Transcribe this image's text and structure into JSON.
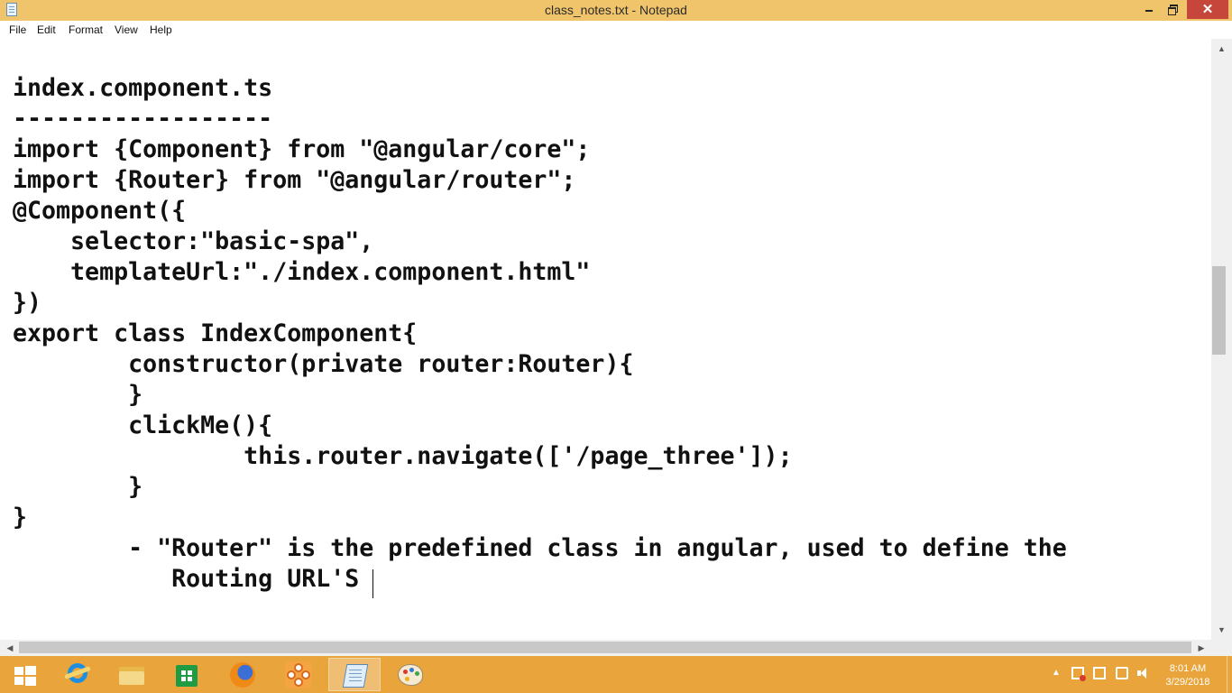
{
  "window": {
    "title": "class_notes.txt - Notepad",
    "controls": {
      "minimize": "",
      "maximize": "",
      "close": "✕"
    }
  },
  "menu": [
    "File",
    "Edit",
    "Format",
    "View",
    "Help"
  ],
  "editor": {
    "text": "index.component.ts\n------------------\nimport {Component} from \"@angular/core\";\nimport {Router} from \"@angular/router\";\n@Component({\n    selector:\"basic-spa\",\n    templateUrl:\"./index.component.html\"\n})\nexport class IndexComponent{\n        constructor(private router:Router){\n        }\n        clickMe(){\n                this.router.navigate(['/page_three']);\n        }\n}\n        - \"Router\" is the predefined class in angular, used to define the\n           Routing URL'S"
  },
  "scrollbars": {
    "up": "▲",
    "down": "▼",
    "left": "◀",
    "right": "▶"
  },
  "taskbar": {
    "apps": [
      "start-icon",
      "internet-explorer-icon",
      "file-explorer-icon",
      "store-icon",
      "firefox-icon",
      "flower-app-icon",
      "notepad-icon",
      "paint-icon"
    ],
    "tray_chevron": "▲",
    "time": "8:01 AM",
    "date": "3/29/2018"
  },
  "colors": {
    "titlebar": "#f0c46a",
    "taskbar": "#e9a53c",
    "close_button": "#c7463c"
  }
}
